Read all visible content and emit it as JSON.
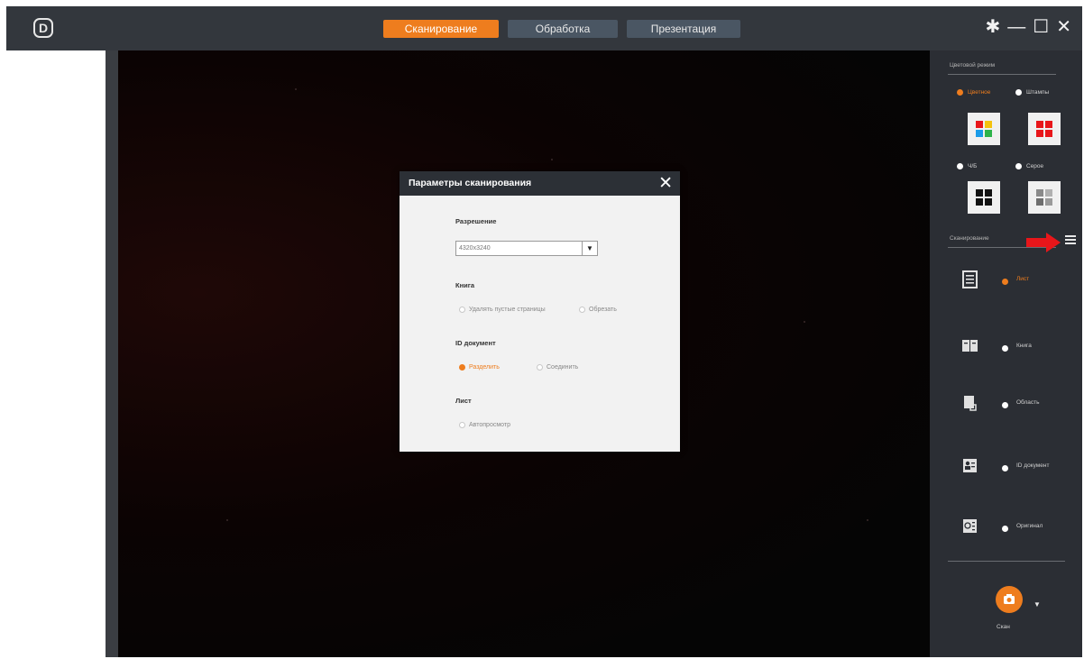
{
  "app": {
    "logo_letter": "D"
  },
  "tabs": [
    {
      "label": "Сканирование",
      "active": true
    },
    {
      "label": "Обработка",
      "active": false
    },
    {
      "label": "Презентация",
      "active": false
    }
  ],
  "window_controls": {
    "settings": "✱",
    "minimize": "—",
    "maximize": "☐",
    "close": "✕"
  },
  "dialog": {
    "title": "Параметры сканирования",
    "close": "✕",
    "resolution_title": "Разрешение",
    "resolution_value": "4320x3240",
    "book_title": "Книга",
    "book_options": [
      "Удалять пустые страницы",
      "Обрезать"
    ],
    "id_title": "ID документ",
    "id_options": [
      "Разделить",
      "Соединить"
    ],
    "sheet_title": "Лист",
    "sheet_options": [
      "Автопросмотр"
    ]
  },
  "right_panel": {
    "color_mode_title": "Цветовой режим",
    "color_modes": [
      "Цветное",
      "Штампы",
      "Ч/Б",
      "Серое"
    ],
    "scan_title": "Сканирование",
    "scan_modes": [
      "Лист",
      "Книга",
      "Область",
      "ID документ",
      "Оригинал"
    ],
    "scan_button_label": "Скан"
  },
  "colors": {
    "accent": "#ee7d1e",
    "titlebar": "#33373d",
    "panel": "#2b2e34",
    "tab": "#4a5663",
    "arrow": "#e8161a"
  }
}
